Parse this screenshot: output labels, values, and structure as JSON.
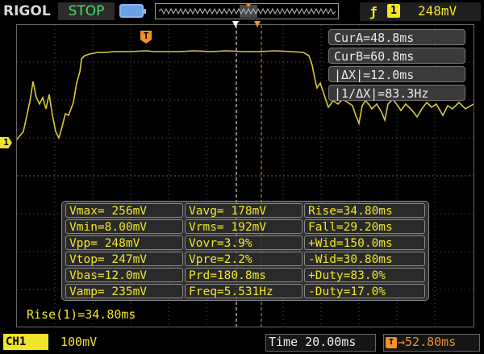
{
  "topbar": {
    "brand": "RIGOL",
    "status": "STOP",
    "trigger": {
      "source": "1",
      "edge_icon": "rising-edge-icon",
      "level": "248mV"
    }
  },
  "cursors": {
    "cur_a": "CurA=48.8ms",
    "cur_b": "CurB=60.8ms",
    "delta_x": "|ΔX|=12.0ms",
    "inv_delta_x": "|1/ΔX|=83.3Hz"
  },
  "measurements": [
    [
      "Vmax= 256mV",
      "Vavg= 178mV",
      "Rise=34.80ms"
    ],
    [
      "Vmin=8.00mV",
      "Vrms= 192mV",
      "Fall=29.20ms"
    ],
    [
      "Vpp= 248mV",
      "Vovr=3.9%",
      "+Wid=150.0ms"
    ],
    [
      "Vtop= 247mV",
      "Vpre=2.2%",
      "-Wid=30.80ms"
    ],
    [
      "Vbas=12.0mV",
      "Prd=180.8ms",
      "+Duty=83.0%"
    ],
    [
      "Vamp= 235mV",
      "Freq=5.531Hz",
      "-Duty=17.0%"
    ]
  ],
  "annotation": "Rise(1)=34.80ms",
  "channel": {
    "label": "CH1",
    "marker": "1",
    "scale": "100mV"
  },
  "timebase": {
    "label": "Time",
    "value": "20.00ms",
    "offset": "52.80ms"
  },
  "trigger_marker": "T",
  "colors": {
    "trace": "#d7c93a",
    "accent": "#f1e52a",
    "cursor": "#f0902a",
    "status_stop": "#4cd86a"
  }
}
